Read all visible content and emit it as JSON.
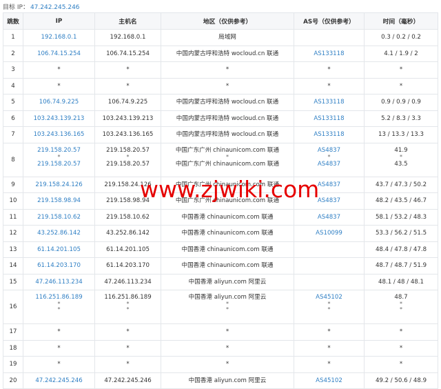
{
  "target": {
    "label": "目标 IP：",
    "ip": "47.242.245.246"
  },
  "headers": {
    "hop": "跳数",
    "ip": "IP",
    "hostname": "主机名",
    "region": "地区（仅供参考）",
    "asn": "AS号（仅供参考）",
    "time": "时间（毫秒）"
  },
  "rows": [
    {
      "hop": "1",
      "entries": [
        {
          "ip": "192.168.0.1",
          "host": "192.168.0.1",
          "region": "局域网",
          "asn": "",
          "time": "0.3 / 0.2 / 0.2"
        }
      ]
    },
    {
      "hop": "2",
      "entries": [
        {
          "ip": "106.74.15.254",
          "host": "106.74.15.254",
          "region": "中国内蒙古呼和浩特 wocloud.cn 联通",
          "asn": "AS133118",
          "time": "4.1 / 1.9 / 2"
        }
      ]
    },
    {
      "hop": "3",
      "entries": [
        {
          "ip": "*",
          "host": "*",
          "region": "*",
          "asn": "*",
          "time": "*"
        }
      ]
    },
    {
      "hop": "4",
      "entries": [
        {
          "ip": "*",
          "host": "*",
          "region": "*",
          "asn": "*",
          "time": "*"
        }
      ]
    },
    {
      "hop": "5",
      "entries": [
        {
          "ip": "106.74.9.225",
          "host": "106.74.9.225",
          "region": "中国内蒙古呼和浩特 wocloud.cn 联通",
          "asn": "AS133118",
          "time": "0.9 / 0.9 / 0.9"
        }
      ]
    },
    {
      "hop": "6",
      "entries": [
        {
          "ip": "103.243.139.213",
          "host": "103.243.139.213",
          "region": "中国内蒙古呼和浩特 wocloud.cn 联通",
          "asn": "AS133118",
          "time": "5.2 / 8.3 / 3.3"
        }
      ]
    },
    {
      "hop": "7",
      "entries": [
        {
          "ip": "103.243.136.165",
          "host": "103.243.136.165",
          "region": "中国内蒙古呼和浩特 wocloud.cn 联通",
          "asn": "AS133118",
          "time": "13 / 13.3 / 13.3"
        }
      ]
    },
    {
      "hop": "8",
      "entries": [
        {
          "ip": "219.158.20.57",
          "host": "219.158.20.57",
          "region": "中国广东广州 chinaunicom.com 联通",
          "asn": "AS4837",
          "time": "41.9"
        },
        {
          "ip": "*",
          "host": "*",
          "region": "*",
          "asn": "*",
          "time": "*"
        },
        {
          "ip": "219.158.20.57",
          "host": "219.158.20.57",
          "region": "中国广东广州 chinaunicom.com 联通",
          "asn": "AS4837",
          "time": "43.5"
        }
      ]
    },
    {
      "hop": "9",
      "entries": [
        {
          "ip": "219.158.24.126",
          "host": "219.158.24.126",
          "region": "中国广东广州 chinaunicom.com 联通",
          "asn": "AS4837",
          "time": "43.7 / 47.3 / 50.2"
        }
      ]
    },
    {
      "hop": "10",
      "entries": [
        {
          "ip": "219.158.98.94",
          "host": "219.158.98.94",
          "region": "中国广东广州 chinaunicom.com 联通",
          "asn": "AS4837",
          "time": "48.2 / 43.5 / 46.7"
        }
      ]
    },
    {
      "hop": "11",
      "entries": [
        {
          "ip": "219.158.10.62",
          "host": "219.158.10.62",
          "region": "中国香港 chinaunicom.com 联通",
          "asn": "AS4837",
          "time": "58.1 / 53.2 / 48.3"
        }
      ]
    },
    {
      "hop": "12",
      "entries": [
        {
          "ip": "43.252.86.142",
          "host": "43.252.86.142",
          "region": "中国香港 chinaunicom.com 联通",
          "asn": "AS10099",
          "time": "53.3 / 56.2 / 51.5"
        }
      ]
    },
    {
      "hop": "13",
      "entries": [
        {
          "ip": "61.14.201.105",
          "host": "61.14.201.105",
          "region": "中国香港 chinaunicom.com 联通",
          "asn": "",
          "time": "48.4 / 47.8 / 47.8"
        }
      ]
    },
    {
      "hop": "14",
      "entries": [
        {
          "ip": "61.14.203.170",
          "host": "61.14.203.170",
          "region": "中国香港 chinaunicom.com 联通",
          "asn": "",
          "time": "48.7 / 48.7 / 51.9"
        }
      ]
    },
    {
      "hop": "15",
      "entries": [
        {
          "ip": "47.246.113.234",
          "host": "47.246.113.234",
          "region": "中国香港 aliyun.com 阿里云",
          "asn": "",
          "time": "48.1 / 48 / 48.1"
        }
      ]
    },
    {
      "hop": "16",
      "entries": [
        {
          "ip": "116.251.86.189",
          "host": "116.251.86.189",
          "region": "中国香港 aliyun.com 阿里云",
          "asn": "AS45102",
          "time": "48.7"
        },
        {
          "ip": "*",
          "host": "*",
          "region": "*",
          "asn": "*",
          "time": "*"
        },
        {
          "ip": "*",
          "host": "*",
          "region": "*",
          "asn": "*",
          "time": "*"
        }
      ]
    },
    {
      "hop": "17",
      "entries": [
        {
          "ip": "*",
          "host": "*",
          "region": "*",
          "asn": "*",
          "time": "*"
        }
      ]
    },
    {
      "hop": "18",
      "entries": [
        {
          "ip": "*",
          "host": "*",
          "region": "*",
          "asn": "*",
          "time": "*"
        }
      ]
    },
    {
      "hop": "19",
      "entries": [
        {
          "ip": "*",
          "host": "*",
          "region": "*",
          "asn": "*",
          "time": "*"
        }
      ]
    },
    {
      "hop": "20",
      "entries": [
        {
          "ip": "47.242.245.246",
          "host": "47.242.245.246",
          "region": "中国香港 aliyun.com 阿里云",
          "asn": "AS45102",
          "time": "49.2 / 50.6 / 48.9"
        }
      ]
    }
  ],
  "watermark": "www.zjwiki.com",
  "colors": {
    "link": "#2f7fc4",
    "watermark": "#e60000",
    "border": "#e3e6ea",
    "header_bg": "#f6f7f9"
  }
}
